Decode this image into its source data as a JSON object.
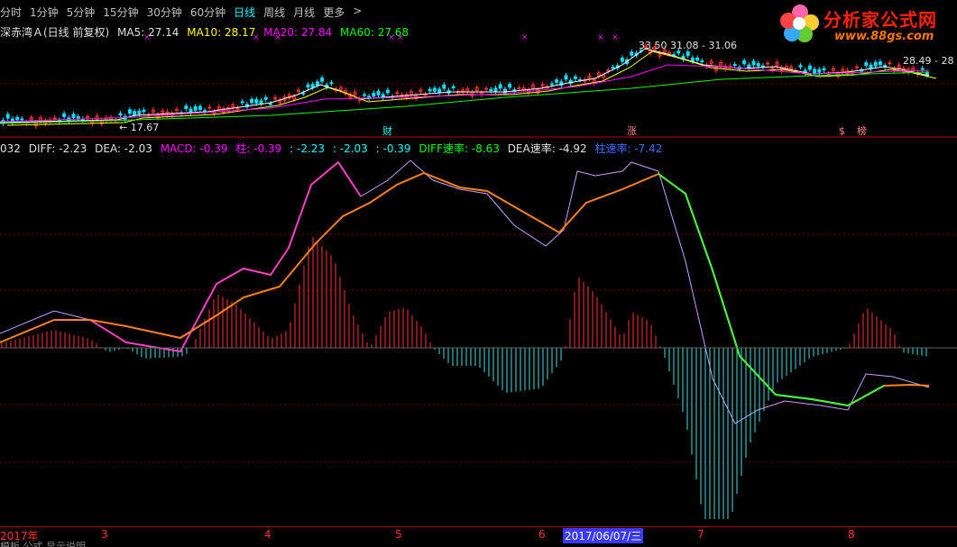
{
  "toolbar": {
    "tabs": [
      {
        "label": "分时",
        "active": false
      },
      {
        "label": "1分钟",
        "active": false
      },
      {
        "label": "5分钟",
        "active": false
      },
      {
        "label": "15分钟",
        "active": false
      },
      {
        "label": "30分钟",
        "active": false
      },
      {
        "label": "60分钟",
        "active": false
      },
      {
        "label": "日线",
        "active": true
      },
      {
        "label": "周线",
        "active": false
      },
      {
        "label": "月线",
        "active": false
      },
      {
        "label": "更多",
        "active": false
      }
    ],
    "more_icon": "chevron-right-icon"
  },
  "logo": {
    "name": "分析家公式网",
    "url": "www.88gs.com"
  },
  "price_panel": {
    "title": "深赤湾Ａ(日线 前复权)",
    "ma5": "MA5: 27.14",
    "ma10": "MA10: 28.17",
    "ma20": "MA20: 27.84",
    "ma60": "MA60: 27.68",
    "low_label": "17.67",
    "high_label": "33.50",
    "range_label": "31.08 - 31.06",
    "right_label": "28.49 - 28",
    "event_tags": [
      "财",
      "涨",
      "$",
      "榜"
    ]
  },
  "macd_panel": {
    "prefix": "032",
    "diff": "DIFF: -2.23",
    "dea": "DEA: -2.03",
    "macd": "MACD: -0.39",
    "zhu": "柱: -0.39",
    "v1": ": -2.23",
    "v2": ": -2.03",
    "v3": ": -0.39",
    "diff_rate": "DIFF速率: -8.63",
    "dea_rate": "DEA速率: -4.92",
    "zhu_rate": "柱速率: -7.42"
  },
  "date_axis": {
    "labels": [
      "2017年",
      "3",
      "4",
      "5",
      "6",
      "7",
      "8"
    ],
    "current": "2017/06/07/三"
  },
  "bottom_strip": "模板  公式  显示说明"
}
